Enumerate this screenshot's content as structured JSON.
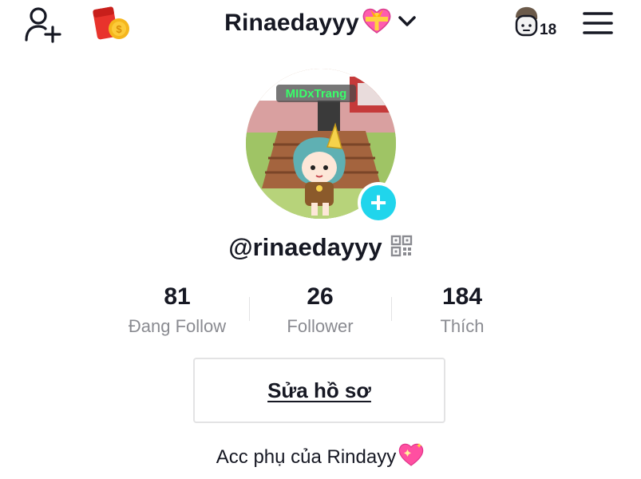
{
  "header": {
    "username": "Rinaedayyy",
    "username_emoji": "heart-with-ribbon",
    "notification_count": "18",
    "icons": {
      "add_friend": "add-user-icon",
      "gift": "red-envelope-icon",
      "dropdown": "chevron-down-icon",
      "visitors": "profile-visitors-icon",
      "menu": "menu-icon"
    }
  },
  "avatar": {
    "overlay_text": "MIDxTrang",
    "add_icon": "plus-icon"
  },
  "profile": {
    "handle": "@rinaedayyy",
    "qr_icon": "qr-code-icon"
  },
  "stats": [
    {
      "value": "81",
      "label": "Đang Follow"
    },
    {
      "value": "26",
      "label": "Follower"
    },
    {
      "value": "184",
      "label": "Thích"
    }
  ],
  "edit_profile_label": "Sửa hồ sơ",
  "bio": {
    "text": "Acc phụ của Rindayy",
    "emoji": "sparkling-heart"
  },
  "colors": {
    "text": "#161823",
    "muted": "#8a8b91",
    "accent": "#20d5ec",
    "heart": "#ff4fa1",
    "border": "#e3e3e4"
  }
}
